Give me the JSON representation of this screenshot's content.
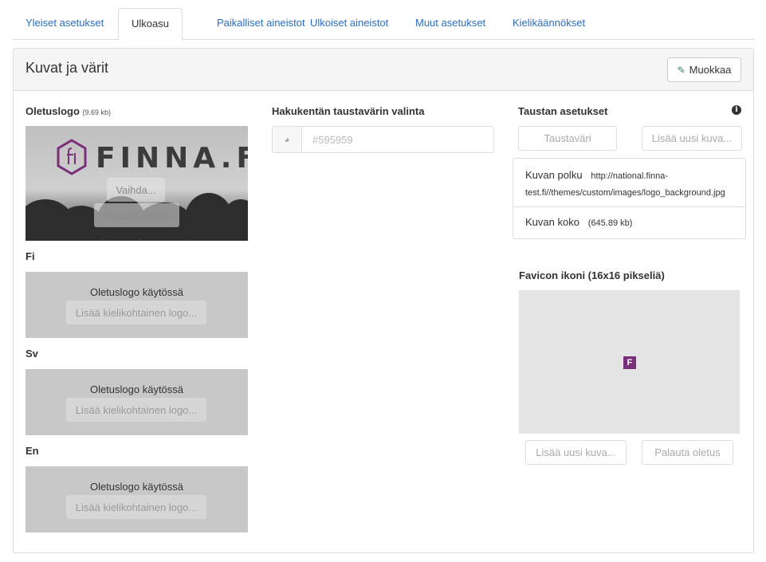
{
  "tabs": [
    {
      "label": "Yleiset asetukset"
    },
    {
      "label": "Ulkoasu"
    },
    {
      "label": "Paikalliset aineistot"
    },
    {
      "label": "Ulkoiset aineistot"
    },
    {
      "label": "Muut asetukset"
    },
    {
      "label": "Kielikäännökset"
    }
  ],
  "panel": {
    "title": "Kuvat ja värit",
    "edit_label": "Muokkaa"
  },
  "logo": {
    "label": "Oletuslogo",
    "size": "(9.69 kb)",
    "brand_text": "FINNA.FI",
    "change_label": "Vaihda...",
    "reset_label": "Palauta oletus"
  },
  "langs": [
    {
      "label": "Fi",
      "status": "Oletuslogo käytössä",
      "add_label": "Lisää kielikohtainen logo..."
    },
    {
      "label": "Sv",
      "status": "Oletuslogo käytössä",
      "add_label": "Lisää kielikohtainen logo..."
    },
    {
      "label": "En",
      "status": "Oletuslogo käytössä",
      "add_label": "Lisää kielikohtainen logo..."
    }
  ],
  "search_color": {
    "label": "Hakukentän taustavärin valinta",
    "value": "#595959"
  },
  "background": {
    "label": "Taustan asetukset",
    "color_button": "Taustaväri",
    "add_image_button": "Lisää uusi kuva...",
    "path_key": "Kuvan polku",
    "path_value_line1": "http://national.finna-",
    "path_value_line2": "test.fi//themes/custom/images/logo_background.jpg",
    "size_key": "Kuvan koko",
    "size_value": "(645.89 kb)"
  },
  "favicon": {
    "label": "Favicon ikoni (16x16 pikseliä)",
    "glyph": "F",
    "add_label": "Lisää uusi kuva...",
    "reset_label": "Palauta oletus"
  },
  "colors": {
    "link": "#2a6fbf",
    "brand_purple": "#7a2f7a",
    "edit_icon": "#2e8b57"
  }
}
